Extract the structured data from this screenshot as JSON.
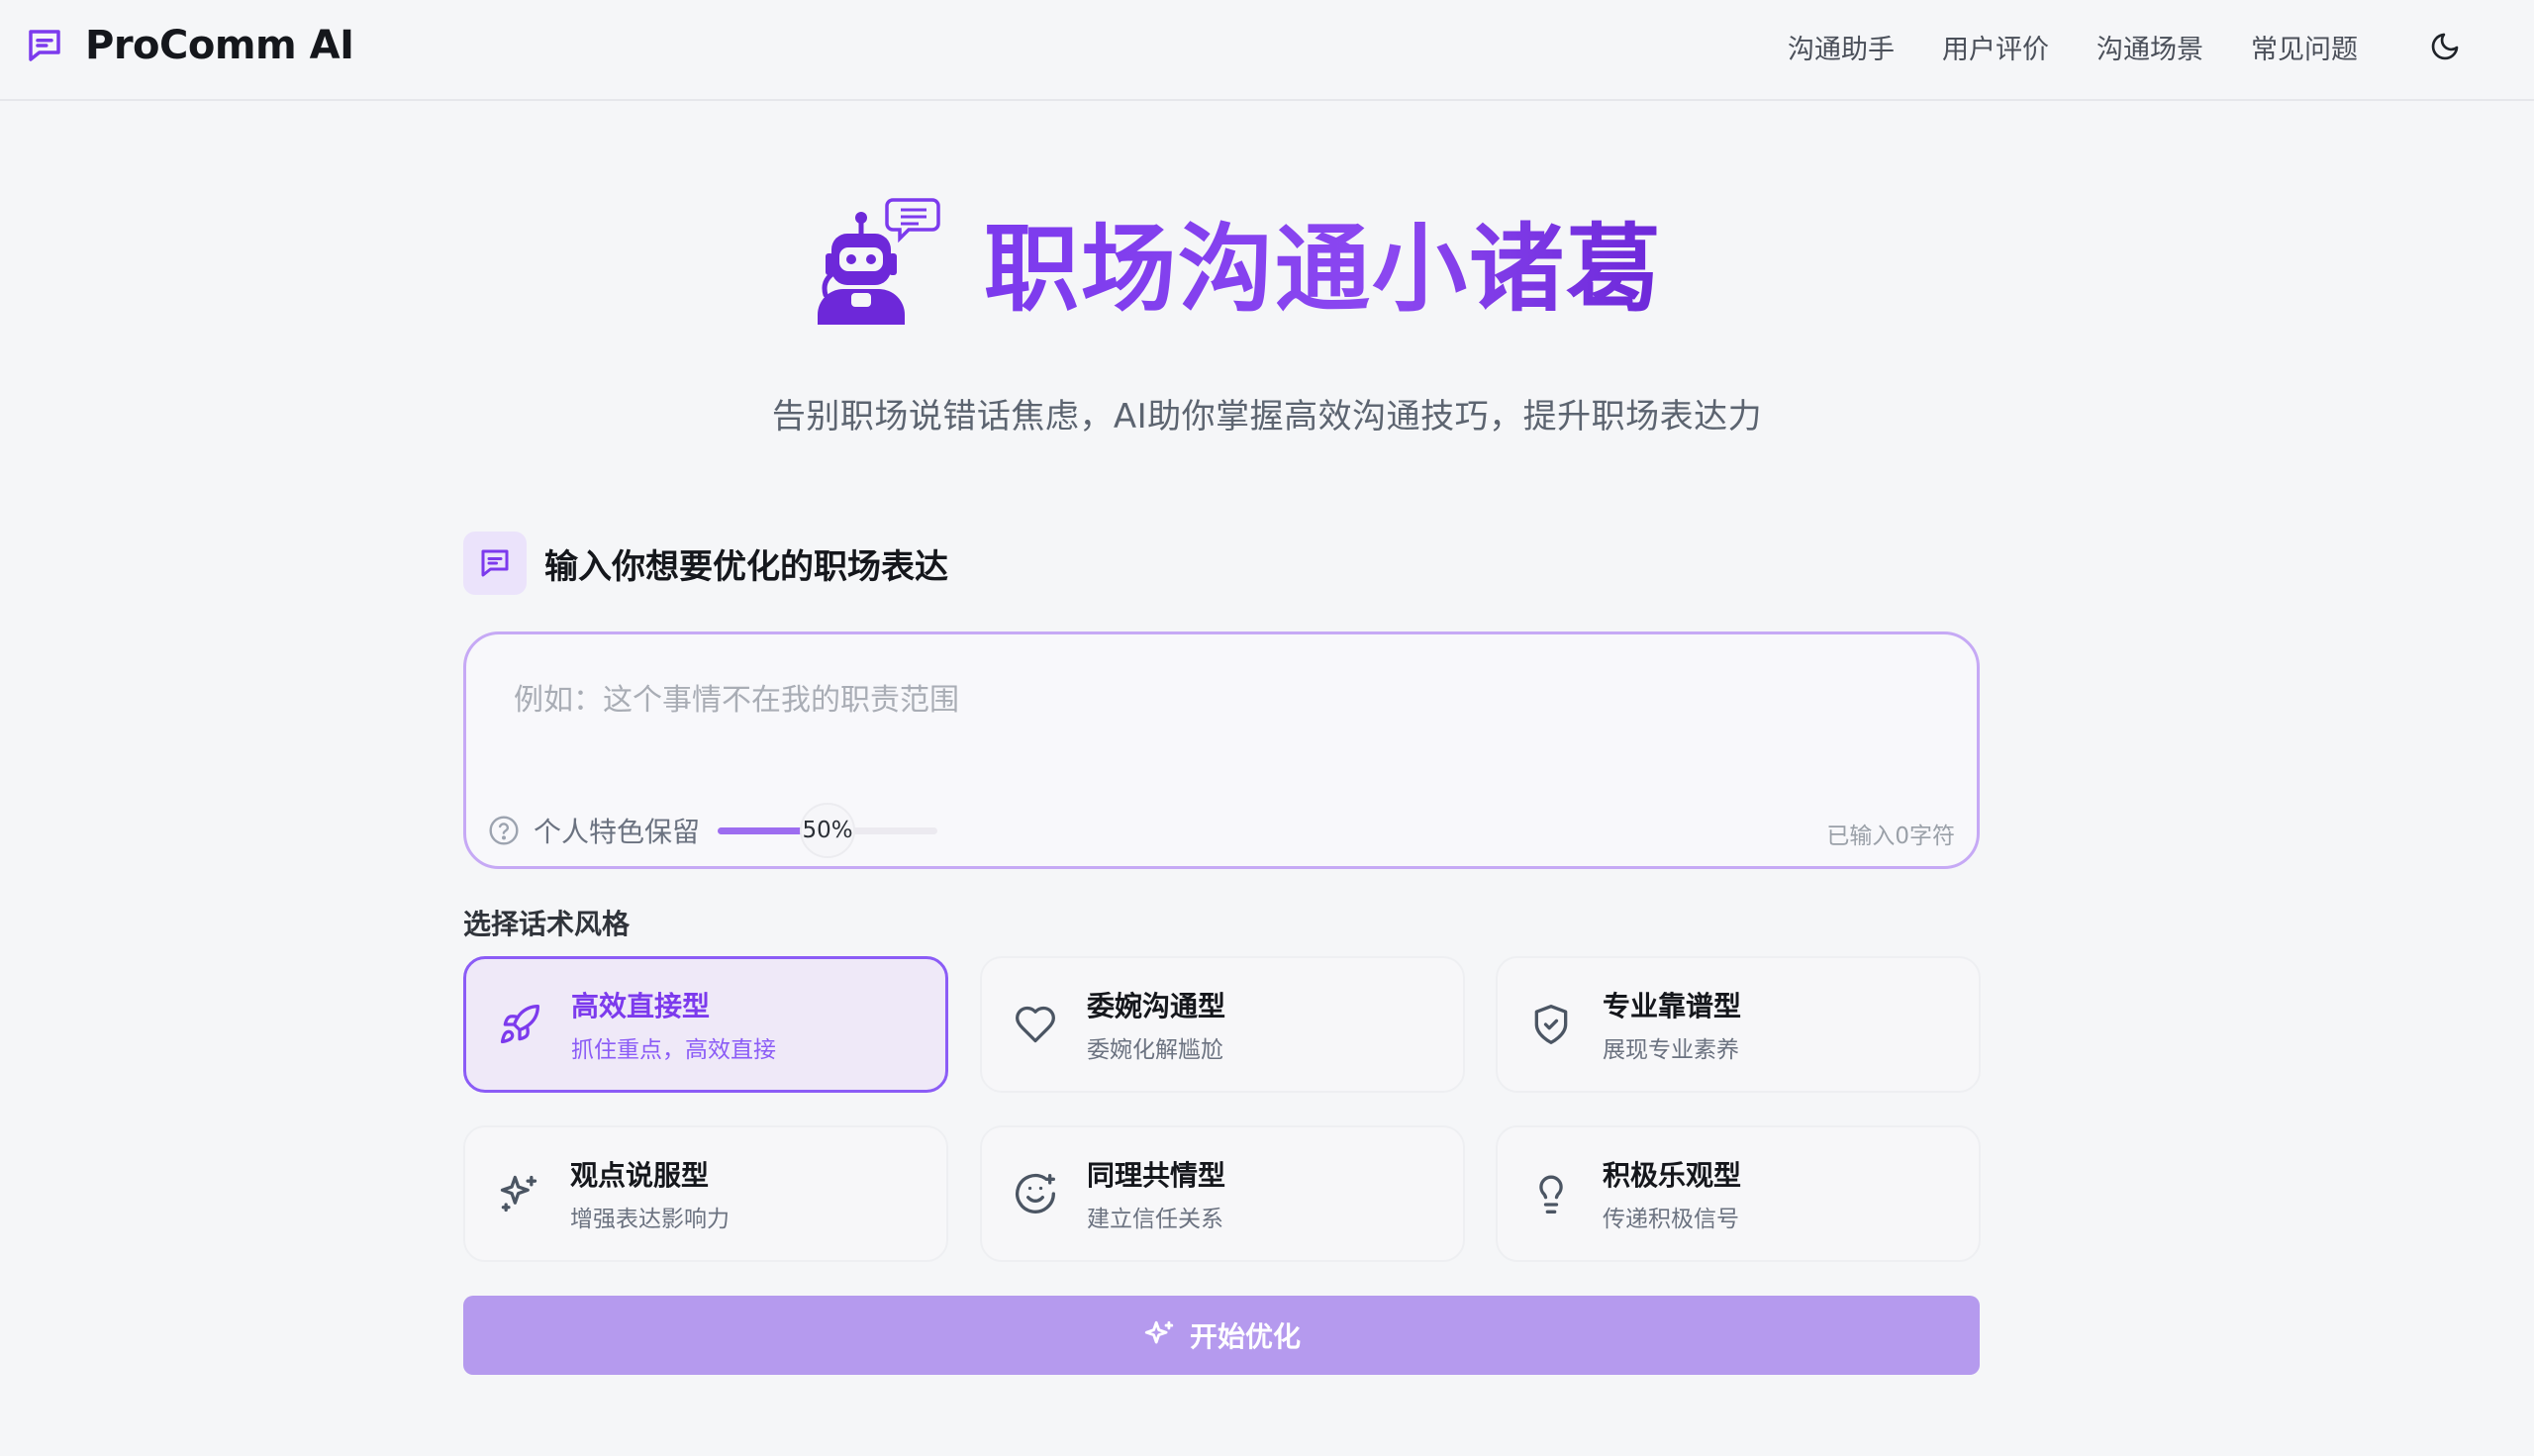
{
  "brand": {
    "name": "ProComm AI"
  },
  "nav": {
    "items": [
      {
        "label": "沟通助手"
      },
      {
        "label": "用户评价"
      },
      {
        "label": "沟通场景"
      },
      {
        "label": "常见问题"
      }
    ],
    "theme_icon": "moon-icon"
  },
  "hero": {
    "title": "职场沟通小诸葛",
    "subtitle": "告别职场说错话焦虑，AI助你掌握高效沟通技巧，提升职场表达力"
  },
  "input_section": {
    "title": "输入你想要优化的职场表达",
    "placeholder": "例如：这个事情不在我的职责范围",
    "value": "",
    "retention_label": "个人特色保留",
    "retention_value": 50,
    "retention_display": "50%",
    "char_count": "已输入0字符"
  },
  "styles": {
    "label": "选择话术风格",
    "selected_index": 0,
    "options": [
      {
        "title": "高效直接型",
        "desc": "抓住重点，高效直接",
        "icon": "rocket-icon"
      },
      {
        "title": "委婉沟通型",
        "desc": "委婉化解尴尬",
        "icon": "heart-icon"
      },
      {
        "title": "专业靠谱型",
        "desc": "展现专业素养",
        "icon": "shield-check-icon"
      },
      {
        "title": "观点说服型",
        "desc": "增强表达影响力",
        "icon": "sparkle-icon"
      },
      {
        "title": "同理共情型",
        "desc": "建立信任关系",
        "icon": "smile-icon"
      },
      {
        "title": "积极乐观型",
        "desc": "传递积极信号",
        "icon": "lightbulb-icon"
      }
    ]
  },
  "action": {
    "start_label": "开始优化"
  },
  "colors": {
    "accent": "#7c3aed",
    "accent_soft": "#b59aee",
    "background": "#f5f6f8"
  }
}
